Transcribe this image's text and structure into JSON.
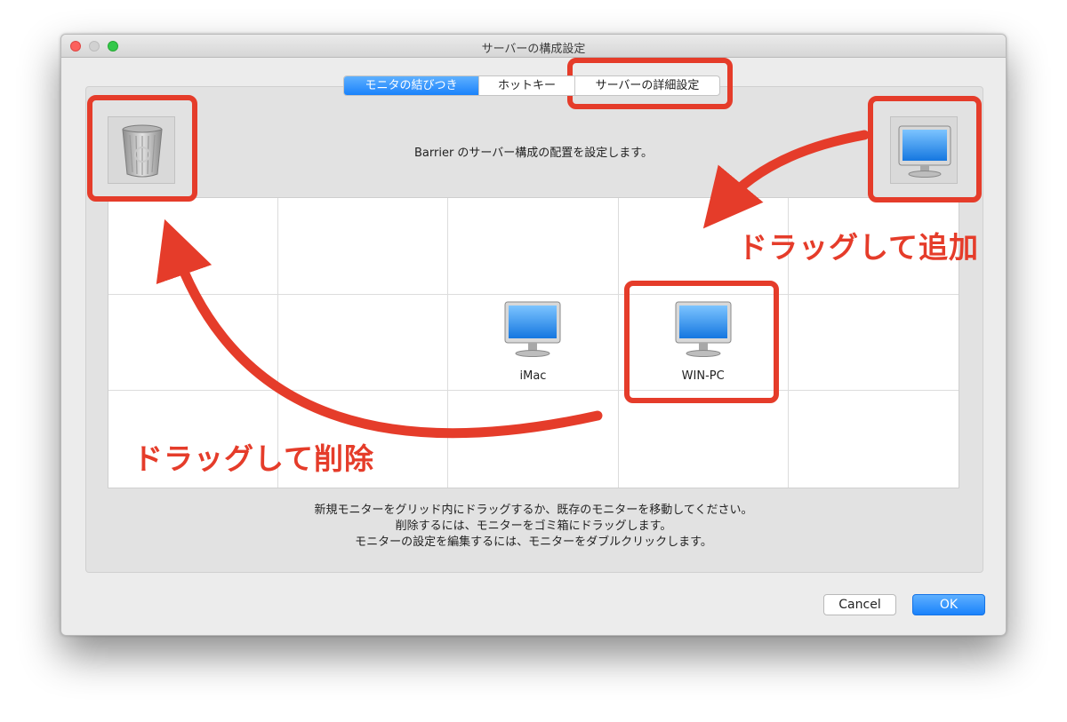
{
  "window": {
    "title": "サーバーの構成設定"
  },
  "tabs": [
    {
      "label": "モニタの結びつき",
      "active": true
    },
    {
      "label": "ホットキー",
      "active": false
    },
    {
      "label": "サーバーの詳細設定",
      "active": false
    }
  ],
  "description": "Barrier のサーバー構成の配置を設定します。",
  "trash": {
    "icon": "trash-can-icon"
  },
  "new_monitor": {
    "icon": "monitor-icon"
  },
  "screens": [
    {
      "name": "iMac",
      "icon": "monitor-icon"
    },
    {
      "name": "WIN-PC",
      "icon": "monitor-icon"
    }
  ],
  "instructions": [
    "新規モニターをグリッド内にドラッグするか、既存のモニターを移動してください。",
    "削除するには、モニターをゴミ箱にドラッグします。",
    "モニターの設定を編集するには、モニターをダブルクリックします。"
  ],
  "buttons": {
    "cancel": "Cancel",
    "ok": "OK"
  },
  "annotations": {
    "add": "ドラッグして追加",
    "delete": "ドラッグして削除",
    "color": "#e53c2a"
  },
  "colors": {
    "accent": "#1a82fb",
    "annotation": "#e53c2a"
  }
}
